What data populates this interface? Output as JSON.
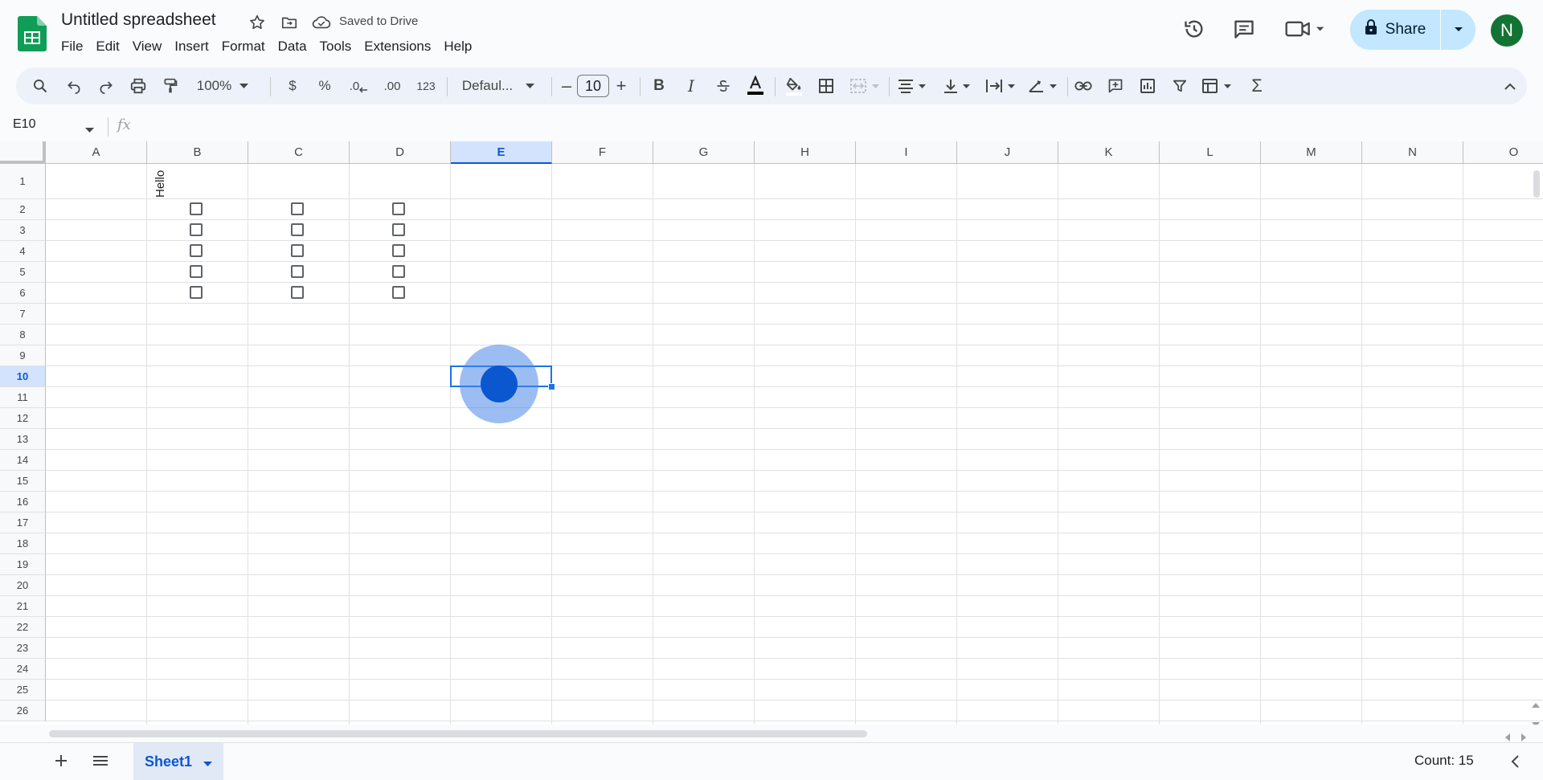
{
  "app": {
    "doc_title": "Untitled spreadsheet",
    "saved_status": "Saved to Drive",
    "share_label": "Share",
    "avatar_initial": "N",
    "brand_color": "#0f9d58"
  },
  "menu": [
    "File",
    "Edit",
    "View",
    "Insert",
    "Format",
    "Data",
    "Tools",
    "Extensions",
    "Help"
  ],
  "toolbar": {
    "zoom": "100%",
    "currency": "$",
    "percent": "%",
    "decrease_decimal": ".0",
    "increase_decimal": ".00",
    "number_format": "123",
    "font": "Defaul...",
    "font_size": "10",
    "minus": "–",
    "plus": "+"
  },
  "formula_bar": {
    "name_box": "E10",
    "fx": "fx",
    "value": ""
  },
  "grid": {
    "columns": [
      "A",
      "B",
      "C",
      "D",
      "E",
      "F",
      "G",
      "H",
      "I",
      "J",
      "K",
      "L",
      "M",
      "N",
      "O"
    ],
    "rows": [
      "1",
      "2",
      "3",
      "4",
      "5",
      "6",
      "7",
      "8",
      "9",
      "10",
      "11",
      "12",
      "13",
      "14",
      "15",
      "16",
      "17",
      "18",
      "19",
      "20",
      "21",
      "22",
      "23",
      "24",
      "25",
      "26"
    ],
    "selected_column": "E",
    "selected_row": "10",
    "cells": {
      "B1": "Hello"
    },
    "checkbox_columns": [
      "B",
      "C",
      "D"
    ],
    "checkbox_rows": [
      "2",
      "3",
      "4",
      "5",
      "6"
    ],
    "selection_color": "#1a73e8"
  },
  "bottom": {
    "sheet_name": "Sheet1",
    "count": "Count: 15"
  }
}
